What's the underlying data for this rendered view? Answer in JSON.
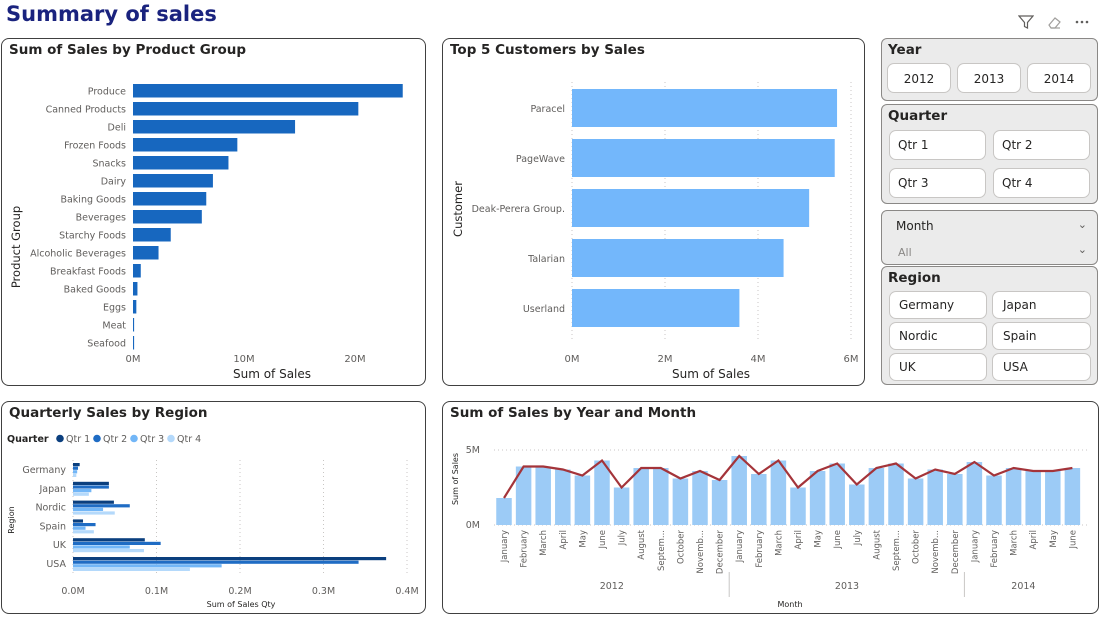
{
  "page": {
    "title": "Summary of sales",
    "toolbar_icons": [
      "filter-icon",
      "eraser-icon",
      "more-icon"
    ]
  },
  "slicers": {
    "year": {
      "title": "Year",
      "options": [
        "2012",
        "2013",
        "2014"
      ]
    },
    "quarter": {
      "title": "Quarter",
      "options": [
        "Qtr 1",
        "Qtr 2",
        "Qtr 3",
        "Qtr 4"
      ]
    },
    "month": {
      "title": "Month",
      "value": "All"
    },
    "region": {
      "title": "Region",
      "options": [
        "Germany",
        "Japan",
        "Nordic",
        "Spain",
        "UK",
        "USA"
      ]
    }
  },
  "chart_data": [
    {
      "id": "product_group",
      "type": "bar",
      "orientation": "horizontal",
      "title": "Sum of Sales by Product Group",
      "xlabel": "Sum of Sales",
      "ylabel": "Product Group",
      "categories": [
        "Produce",
        "Canned Products",
        "Deli",
        "Frozen Foods",
        "Snacks",
        "Dairy",
        "Baking Goods",
        "Beverages",
        "Starchy Foods",
        "Alcoholic Beverages",
        "Breakfast Foods",
        "Baked Goods",
        "Eggs",
        "Meat",
        "Seafood"
      ],
      "values": [
        24.3,
        20.3,
        14.6,
        9.4,
        8.6,
        7.2,
        6.6,
        6.2,
        3.4,
        2.3,
        0.7,
        0.4,
        0.3,
        0.1,
        0.1
      ],
      "unit": "M",
      "xticks": [
        "0M",
        "10M",
        "20M"
      ],
      "xlim": [
        0,
        25
      ],
      "color": "#1767bf"
    },
    {
      "id": "top_customers",
      "type": "bar",
      "orientation": "horizontal",
      "title": "Top 5 Customers by Sales",
      "xlabel": "Sum of Sales",
      "ylabel": "Customer",
      "categories": [
        "Paracel",
        "PageWave",
        "Deak-Perera Group.",
        "Talarian",
        "Userland"
      ],
      "values": [
        5.7,
        5.65,
        5.1,
        4.55,
        3.6
      ],
      "unit": "M",
      "xticks": [
        "0M",
        "2M",
        "4M",
        "6M"
      ],
      "xlim": [
        0,
        6
      ],
      "color": "#73b7fb"
    },
    {
      "id": "quarterly_region",
      "type": "bar",
      "orientation": "horizontal",
      "title": "Quarterly Sales by Region",
      "xlabel": "Sum of Sales Qty",
      "ylabel": "Region",
      "legend_title": "Quarter",
      "categories": [
        "Germany",
        "Japan",
        "Nordic",
        "Spain",
        "UK",
        "USA"
      ],
      "series": [
        {
          "name": "Qtr 1",
          "color": "#0b3f7e",
          "values": [
            0.008,
            0.043,
            0.049,
            0.012,
            0.086,
            0.375
          ]
        },
        {
          "name": "Qtr 2",
          "color": "#1f6cc4",
          "values": [
            0.006,
            0.043,
            0.068,
            0.027,
            0.105,
            0.342
          ]
        },
        {
          "name": "Qtr 3",
          "color": "#72b6f7",
          "values": [
            0.005,
            0.022,
            0.036,
            0.015,
            0.068,
            0.178
          ]
        },
        {
          "name": "Qtr 4",
          "color": "#b4d9fb",
          "values": [
            0.004,
            0.019,
            0.05,
            0.025,
            0.085,
            0.14
          ]
        }
      ],
      "xticks": [
        "0.0M",
        "0.1M",
        "0.2M",
        "0.3M",
        "0.4M"
      ],
      "xlim": [
        0,
        0.4
      ]
    },
    {
      "id": "year_month",
      "type": "bar",
      "combo_line": true,
      "title": "Sum of Sales by Year and Month",
      "xlabel": "Month",
      "ylabel": "Sum of Sales",
      "months": [
        "January",
        "February",
        "March",
        "April",
        "May",
        "June",
        "July",
        "August",
        "Septem...",
        "October",
        "Novemb...",
        "December",
        "January",
        "February",
        "March",
        "April",
        "May",
        "June",
        "July",
        "August",
        "Septem...",
        "October",
        "Novemb...",
        "December",
        "January",
        "February",
        "March",
        "April",
        "May",
        "June"
      ],
      "years": [
        {
          "label": "2012",
          "count": 12
        },
        {
          "label": "2013",
          "count": 12
        },
        {
          "label": "2014",
          "count": 6
        }
      ],
      "values": [
        1.8,
        3.9,
        3.9,
        3.7,
        3.3,
        4.3,
        2.5,
        3.8,
        3.8,
        3.1,
        3.6,
        3.0,
        4.6,
        3.4,
        4.3,
        2.5,
        3.6,
        4.1,
        2.7,
        3.8,
        4.1,
        3.1,
        3.7,
        3.4,
        4.2,
        3.3,
        3.8,
        3.6,
        3.6,
        3.8
      ],
      "line_values": [
        1.8,
        3.9,
        3.9,
        3.7,
        3.3,
        4.3,
        2.5,
        3.8,
        3.8,
        3.1,
        3.6,
        3.0,
        4.6,
        3.4,
        4.3,
        2.5,
        3.6,
        4.1,
        2.7,
        3.8,
        4.1,
        3.1,
        3.7,
        3.4,
        4.2,
        3.3,
        3.8,
        3.6,
        3.6,
        3.8
      ],
      "yticks": [
        "0M",
        "5M"
      ],
      "ylim": [
        0,
        5
      ],
      "bar_color": "#9ccbf6",
      "line_color": "#a4343a"
    }
  ]
}
